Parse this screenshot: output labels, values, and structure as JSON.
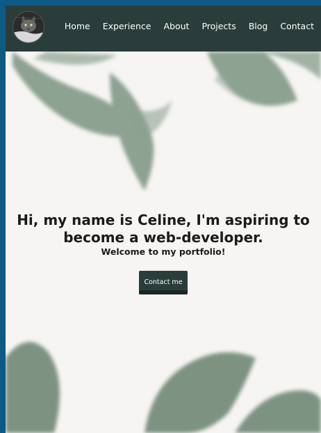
{
  "nav": {
    "links": [
      "Home",
      "Experience",
      "About",
      "Projects",
      "Blog",
      "Contact"
    ]
  },
  "hero": {
    "title": "Hi, my name is Celine, I'm aspiring to become a web-developer.",
    "subtitle": "Welcome to my portfolio!",
    "cta_label": "Contact me"
  },
  "colors": {
    "nav_bg": "#2a3d3b",
    "page_border": "#0d5a86",
    "hero_bg": "#f6f5f3",
    "leaf": "#5f7a65"
  },
  "icons": {
    "avatar": "cat-avatar"
  }
}
